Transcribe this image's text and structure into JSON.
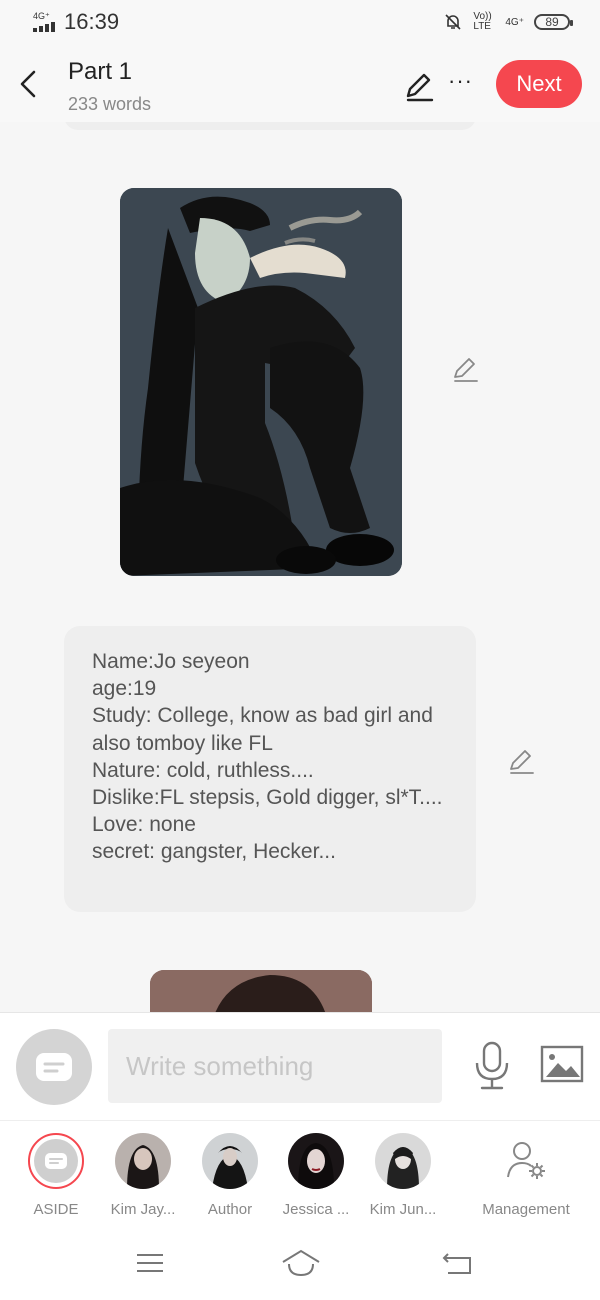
{
  "status_bar": {
    "network": "4G⁺",
    "time": "16:39",
    "volte": "Vo)) LTE",
    "network_right": "4G⁺",
    "battery": "89",
    "icons": [
      "signal-icon",
      "mute-bell-icon",
      "battery-icon"
    ]
  },
  "header": {
    "title": "Part 1",
    "word_count": "233 words",
    "more_label": "···",
    "next_label": "Next",
    "icons": [
      "back-arrow-icon",
      "pencil-icon",
      "more-icon"
    ],
    "accent": "#f5474f"
  },
  "content": {
    "text_block": [
      "Name:Jo seyeon",
      "age:19",
      "Study: College, know as bad girl and also tomboy like FL",
      "Nature: cold, ruthless....",
      "Dislike:FL stepsis, Gold digger, sl*T....",
      "Love: none",
      "secret: gangster, Hecker..."
    ]
  },
  "compose": {
    "placeholder": "Write something",
    "icons": [
      "aside-chat-icon",
      "microphone-icon",
      "image-icon"
    ]
  },
  "characters": [
    {
      "label": "ASIDE"
    },
    {
      "label": "Kim Jay..."
    },
    {
      "label": "Author"
    },
    {
      "label": "Jessica ..."
    },
    {
      "label": "Kim Jun..."
    },
    {
      "label": "Management"
    }
  ],
  "nav_bar": {
    "icons": [
      "menu-icon",
      "home-icon",
      "back-icon"
    ]
  }
}
